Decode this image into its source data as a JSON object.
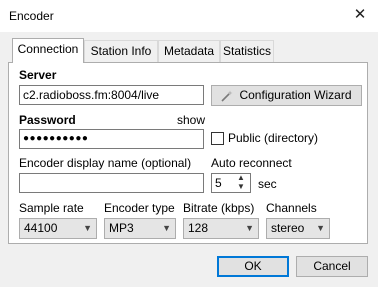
{
  "window": {
    "title": "Encoder",
    "close_glyph": "✕"
  },
  "tabs": [
    {
      "label": "Connection",
      "active": true
    },
    {
      "label": "Station Info",
      "active": false
    },
    {
      "label": "Metadata",
      "active": false
    },
    {
      "label": "Statistics",
      "active": false
    }
  ],
  "server": {
    "label": "Server",
    "value": "c2.radioboss.fm:8004/live"
  },
  "wizard": {
    "label": "Configuration Wizard",
    "icon": "magic-wand-icon"
  },
  "password": {
    "label": "Password",
    "show_label": "show",
    "masked_value": "●●●●●●●●●●"
  },
  "public": {
    "label": "Public (directory)",
    "checked": false
  },
  "display_name": {
    "label": "Encoder display name (optional)",
    "value": ""
  },
  "auto_reconnect": {
    "label": "Auto reconnect",
    "value": "5",
    "unit": "sec"
  },
  "sample_rate": {
    "label": "Sample rate",
    "value": "44100"
  },
  "encoder_type": {
    "label": "Encoder type",
    "value": "MP3"
  },
  "bitrate": {
    "label": "Bitrate (kbps)",
    "value": "128"
  },
  "channels": {
    "label": "Channels",
    "value": "stereo"
  },
  "buttons": {
    "ok": "OK",
    "cancel": "Cancel"
  },
  "colors": {
    "accent": "#0078d7",
    "panel": "#ffffff",
    "window": "#f0f0f0"
  }
}
